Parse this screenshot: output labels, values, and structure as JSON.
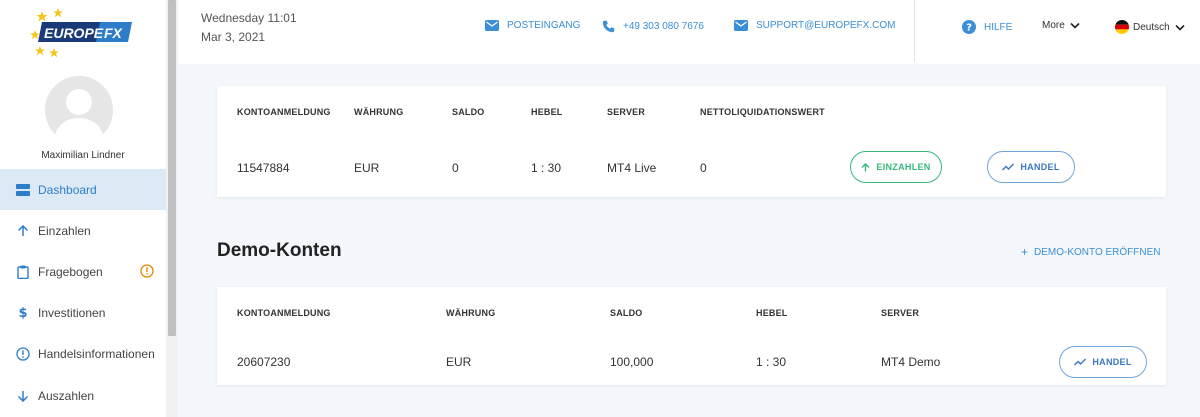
{
  "brand": {
    "logo_word1": "EUROPE",
    "logo_word2": "FX"
  },
  "user": {
    "name": "Maximilian Lindner"
  },
  "sidebar": {
    "items": [
      {
        "label": "Dashboard",
        "icon": "dashboard-icon",
        "active": true
      },
      {
        "label": "Einzahlen",
        "icon": "arrow-up-icon"
      },
      {
        "label": "Fragebogen",
        "icon": "clipboard-icon",
        "warning": true
      },
      {
        "label": "Investitionen",
        "icon": "dollar-icon"
      },
      {
        "label": "Handelsinformationen",
        "icon": "info-icon"
      },
      {
        "label": "Auszahlen",
        "icon": "arrow-down-icon"
      }
    ]
  },
  "header": {
    "day_time": "Wednesday 11:01",
    "date": "Mar 3, 2021",
    "inbox": "POSTEINGANG",
    "phone": "+49 303 080 7676",
    "email": "SUPPORT@EUROPEFX.COM",
    "help": "HILFE",
    "more": "More",
    "language": "Deutsch"
  },
  "live_account": {
    "headers": [
      "KONTOANMELDUNG",
      "WÄHRUNG",
      "SALDO",
      "HEBEL",
      "SERVER",
      "NETTOLIQUIDATIONSWERT"
    ],
    "row": [
      "11547884",
      "EUR",
      "0",
      "1 : 30",
      "MT4 Live",
      "0"
    ],
    "deposit_button": "EINZAHLEN",
    "trade_button": "HANDEL"
  },
  "demo": {
    "heading": "Demo-Konten",
    "open_link": "DEMO-KONTO ERÖFFNEN",
    "headers": [
      "KONTOANMELDUNG",
      "WÄHRUNG",
      "SALDO",
      "HEBEL",
      "SERVER"
    ],
    "row": [
      "20607230",
      "EUR",
      "100,000",
      "1 : 30",
      "MT4 Demo"
    ],
    "trade_button": "HANDEL"
  },
  "colors": {
    "accent": "#3a8fd6",
    "active_bg": "#dceaf6",
    "deposit_green": "#34b97a",
    "warning": "#e08a00",
    "background": "#f4f7fb"
  }
}
